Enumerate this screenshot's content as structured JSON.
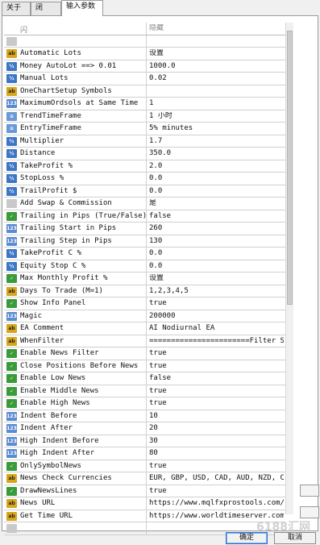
{
  "tabs": [
    {
      "label": "关于",
      "active": false
    },
    {
      "label": "闭",
      "active": false
    },
    {
      "label": "输入参数",
      "active": true
    }
  ],
  "header": {
    "name": "闪",
    "value": "隐藏"
  },
  "params": [
    {
      "icon": "blank",
      "name": "",
      "value": ""
    },
    {
      "icon": "ab",
      "name": "Automatic Lots",
      "value": "设置"
    },
    {
      "icon": "v2",
      "name": "Money AutoLot ==> 0.01",
      "value": "1000.0"
    },
    {
      "icon": "v2",
      "name": "Manual Lots",
      "value": "0.02"
    },
    {
      "icon": "ab",
      "name": "OneChartSetup Symbols",
      "value": ""
    },
    {
      "icon": "n123",
      "name": "MaximumOrdsols at Same Time",
      "value": "1"
    },
    {
      "icon": "list",
      "name": "TrendTimeFrame",
      "value": "1 小时"
    },
    {
      "icon": "list",
      "name": "EntryTimeFrame",
      "value": "5% minutes"
    },
    {
      "icon": "v2",
      "name": "Multiplier",
      "value": "1.7"
    },
    {
      "icon": "v2",
      "name": "Distance",
      "value": "350.0"
    },
    {
      "icon": "v2",
      "name": "TakeProfit %",
      "value": "2.0"
    },
    {
      "icon": "v2",
      "name": "StopLoss %",
      "value": "0.0"
    },
    {
      "icon": "v2",
      "name": "TrailProfit $",
      "value": "0.0"
    },
    {
      "icon": "blank",
      "name": "Add Swap & Commission",
      "value": "是"
    },
    {
      "icon": "bool",
      "name": "Trailing in Pips (True/False)",
      "value": "false"
    },
    {
      "icon": "n123",
      "name": "Trailing Start in Pips",
      "value": "260"
    },
    {
      "icon": "n123",
      "name": "Trailing Step in Pips",
      "value": "130"
    },
    {
      "icon": "v2",
      "name": "TakeProfit C %",
      "value": "0.0"
    },
    {
      "icon": "v2",
      "name": "Equity Stop C %",
      "value": "0.0"
    },
    {
      "icon": "bool",
      "name": "Max Monthly Profit %",
      "value": "设置"
    },
    {
      "icon": "ab",
      "name": "Days To Trade (M=1)",
      "value": "1,2,3,4,5"
    },
    {
      "icon": "bool",
      "name": "Show Info Panel",
      "value": "true"
    },
    {
      "icon": "n123",
      "name": "Magic",
      "value": "200000"
    },
    {
      "icon": "ab",
      "name": "EA Comment",
      "value": "AI Nodiurnal EA"
    },
    {
      "icon": "ab",
      "name": "WhenFilter",
      "value": "=======================Filter Settings <=..."
    },
    {
      "icon": "bool",
      "name": "Enable News Filter",
      "value": "true"
    },
    {
      "icon": "bool",
      "name": "Close Positions Before News",
      "value": "true"
    },
    {
      "icon": "bool",
      "name": "Enable Low News",
      "value": "false"
    },
    {
      "icon": "bool",
      "name": "Enable Middle News",
      "value": "true"
    },
    {
      "icon": "bool",
      "name": "Enable High News",
      "value": "true"
    },
    {
      "icon": "n123",
      "name": "Indent Before",
      "value": "10"
    },
    {
      "icon": "n123",
      "name": "Indent After",
      "value": "20"
    },
    {
      "icon": "n123",
      "name": "High Indent Before",
      "value": "30"
    },
    {
      "icon": "n123",
      "name": "High Indent After",
      "value": "80"
    },
    {
      "icon": "bool",
      "name": "OnlySymbolNews",
      "value": "true"
    },
    {
      "icon": "ab",
      "name": "News Check Currencies",
      "value": "EUR, GBP, USD, CAD, AUD, NZD, CHF"
    },
    {
      "icon": "bool",
      "name": "DrawNewsLines",
      "value": "true"
    },
    {
      "icon": "ab",
      "name": "News URL",
      "value": "https://www.mqlfxprostools.com/"
    },
    {
      "icon": "ab",
      "name": "Get Time URL",
      "value": "https://www.worldtimeserver.com/"
    },
    {
      "icon": "blank",
      "name": "",
      "value": ""
    }
  ],
  "buttons": {
    "ok": "确定",
    "cancel": "取消"
  },
  "watermark": "6188汇网"
}
